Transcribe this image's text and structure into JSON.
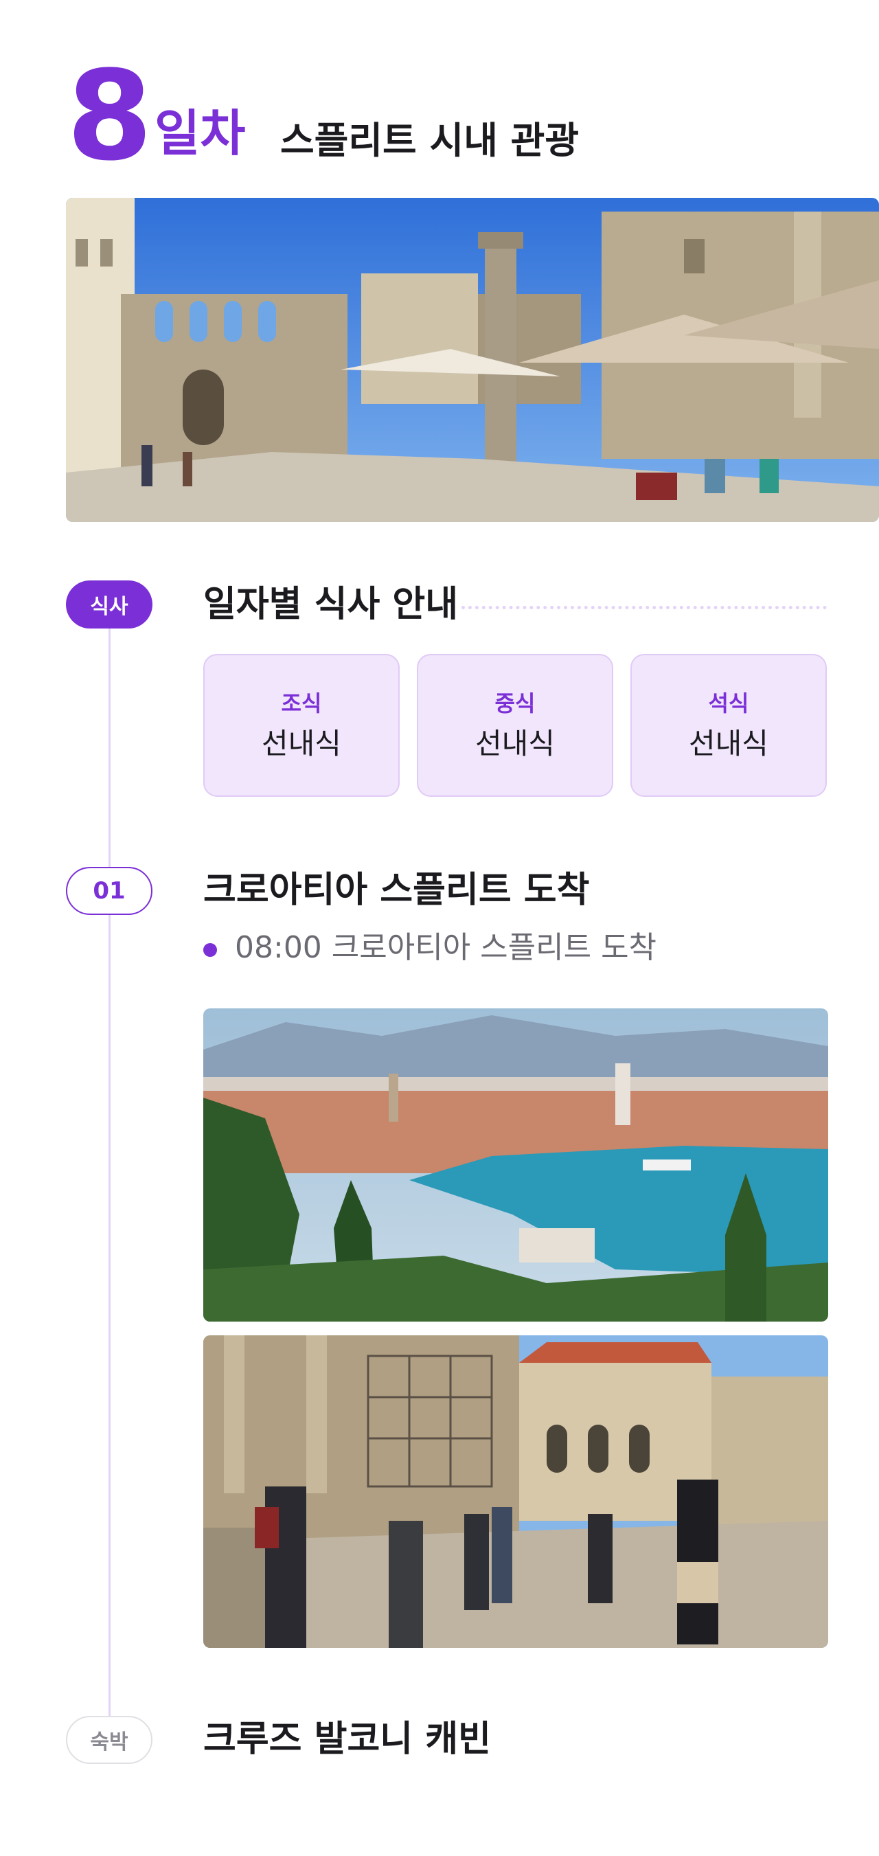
{
  "header": {
    "day_number": "8",
    "day_suffix": "일차",
    "title": "스플리트 시내 관광"
  },
  "meals": {
    "badge": "식사",
    "section_title": "일자별 식사 안내",
    "items": [
      {
        "type": "조식",
        "value": "선내식"
      },
      {
        "type": "중식",
        "value": "선내식"
      },
      {
        "type": "석식",
        "value": "선내식"
      }
    ]
  },
  "schedule": {
    "badge": "01",
    "title": "크로아티아 스플리트 도착",
    "bullets": [
      {
        "text": "08:00 크로아티아 스플리트 도착"
      }
    ]
  },
  "lodging": {
    "badge": "숙박",
    "title": "크루즈 발코니 캐빈"
  },
  "colors": {
    "accent": "#7b2fd6",
    "accent_light": "#f1e6fc",
    "timeline": "#e3d4f7"
  }
}
